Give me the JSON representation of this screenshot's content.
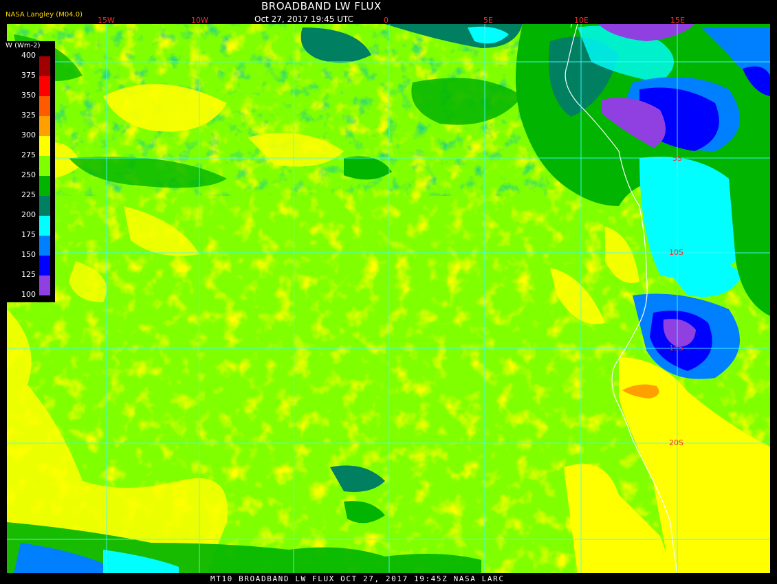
{
  "header": {
    "org": "NASA Langley (M04.0)",
    "title": "BROADBAND LW FLUX",
    "time": "Oct 27, 2017 19:45 UTC"
  },
  "colorbar": {
    "title": "W (Wm-2)",
    "ticks": [
      "400",
      "375",
      "350",
      "325",
      "300",
      "275",
      "250",
      "225",
      "200",
      "175",
      "150",
      "125",
      "100"
    ],
    "colors": [
      "#5a0000",
      "#a00000",
      "#ff0000",
      "#ff5a00",
      "#ffa000",
      "#ffff00",
      "#80ff00",
      "#00b400",
      "#008060",
      "#00ffff",
      "#0080ff",
      "#0000ff",
      "#9040e0"
    ]
  },
  "grid": {
    "lon_labels": [
      "15W",
      "10W",
      "0",
      "5E",
      "10E",
      "15E"
    ],
    "lat_labels": [
      "5S",
      "10S",
      "15S",
      "20S"
    ]
  },
  "footer": "MT10  BROADBAND LW FLUX   OCT 27, 2017 19:45Z   NASA LARC"
}
